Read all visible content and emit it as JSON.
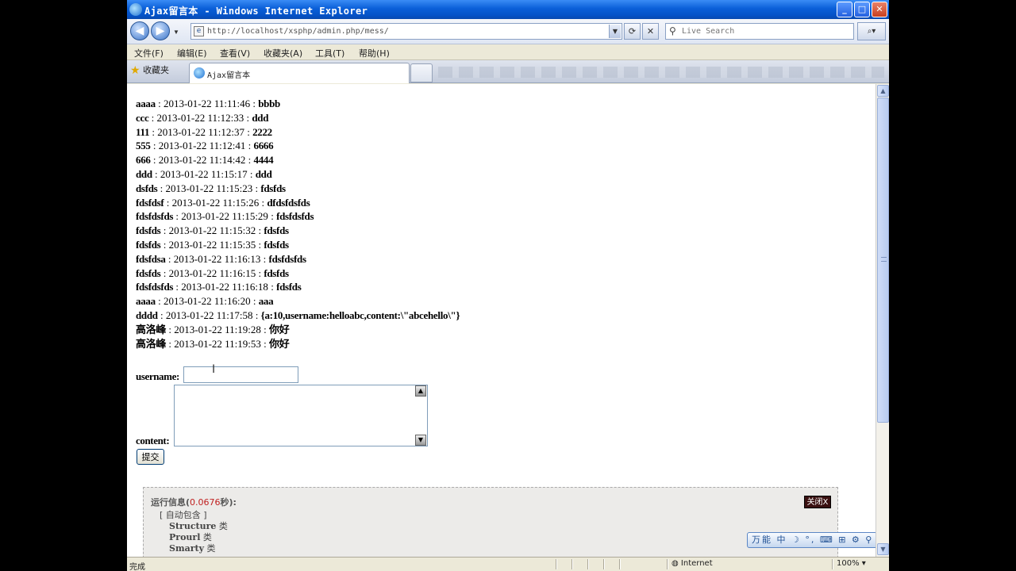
{
  "window": {
    "title": "Ajax留言本 - Windows Internet Explorer",
    "min_glyph": "_",
    "max_glyph": "□",
    "close_glyph": "✕"
  },
  "address": {
    "url": "http://localhost/xsphp/admin.php/mess/"
  },
  "search": {
    "placeholder": "Live Search"
  },
  "menu": {
    "items": [
      "文件(F)",
      "编辑(E)",
      "查看(V)",
      "收藏夹(A)",
      "工具(T)",
      "帮助(H)"
    ]
  },
  "tabs": {
    "favorites_label": "收藏夹",
    "active_tab_label": "Ajax留言本"
  },
  "messages": [
    {
      "user": "aaaa",
      "time": "2013-01-22 11:11:46",
      "content": "bbbb"
    },
    {
      "user": "ccc",
      "time": "2013-01-22 11:12:33",
      "content": "ddd"
    },
    {
      "user": "111",
      "time": "2013-01-22 11:12:37",
      "content": "2222"
    },
    {
      "user": "555",
      "time": "2013-01-22 11:12:41",
      "content": "6666"
    },
    {
      "user": "666",
      "time": "2013-01-22 11:14:42",
      "content": "4444"
    },
    {
      "user": "ddd",
      "time": "2013-01-22 11:15:17",
      "content": "ddd"
    },
    {
      "user": "dsfds",
      "time": "2013-01-22 11:15:23",
      "content": "fdsfds"
    },
    {
      "user": "fdsfdsf",
      "time": "2013-01-22 11:15:26",
      "content": "dfdsfdsfds"
    },
    {
      "user": "fdsfdsfds",
      "time": "2013-01-22 11:15:29",
      "content": "fdsfdsfds"
    },
    {
      "user": "fdsfds",
      "time": "2013-01-22 11:15:32",
      "content": "fdsfds"
    },
    {
      "user": "fdsfds",
      "time": "2013-01-22 11:15:35",
      "content": "fdsfds"
    },
    {
      "user": "fdsfdsa",
      "time": "2013-01-22 11:16:13",
      "content": "fdsfdsfds"
    },
    {
      "user": "fdsfds",
      "time": "2013-01-22 11:16:15",
      "content": "fdsfds"
    },
    {
      "user": "fdsfdsfds",
      "time": "2013-01-22 11:16:18",
      "content": "fdsfds"
    },
    {
      "user": "aaaa",
      "time": "2013-01-22 11:16:20",
      "content": "aaa"
    },
    {
      "user": "dddd",
      "time": "2013-01-22 11:17:58",
      "content": "{a:10,username:helloabc,content:\\\"abcehello\\\"}"
    },
    {
      "user": "高洛峰",
      "time": "2013-01-22 11:19:28",
      "content": "你好"
    },
    {
      "user": "高洛峰",
      "time": "2013-01-22 11:19:53",
      "content": "你好"
    }
  ],
  "form": {
    "username_label": "username:",
    "username_value": "",
    "content_label": "content:",
    "content_value": "",
    "submit_label": "提交"
  },
  "trace": {
    "title_prefix": "运行信息(",
    "time": "0.0676",
    "title_suffix": "秒):",
    "close_label": "关闭X",
    "include_label": "[ 自动包含 ]",
    "classes": [
      {
        "name": "Structure",
        "suffix": "类"
      },
      {
        "name": "Prourl",
        "suffix": "类"
      },
      {
        "name": "Smarty",
        "suffix": "类"
      }
    ]
  },
  "floatbar": {
    "label": "万能 中 ☽ °, ⌨ ⊞ ⚙ ⚲"
  },
  "status": {
    "text": "完成",
    "zone": "Internet",
    "zoom": "100%"
  }
}
